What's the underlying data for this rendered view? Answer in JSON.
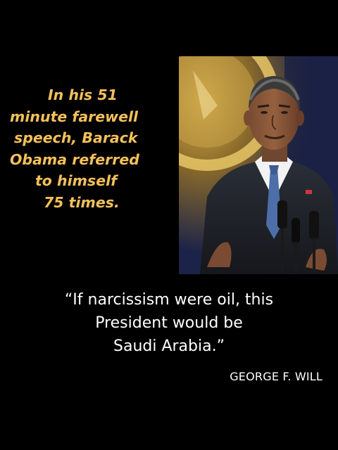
{
  "headline": {
    "lines": [
      "In his 51",
      "minute farewell",
      "speech, Barack",
      "Obama referred",
      "to himself",
      "75 times."
    ]
  },
  "quote": {
    "lines": [
      "“If narcissism were oil, this",
      "President would be",
      "Saudi Arabia.”"
    ]
  },
  "attribution": "GEORGE F. WILL",
  "colors": {
    "background": "#000000",
    "headline_text": "#f3c05a",
    "quote_text": "#ffffff"
  }
}
